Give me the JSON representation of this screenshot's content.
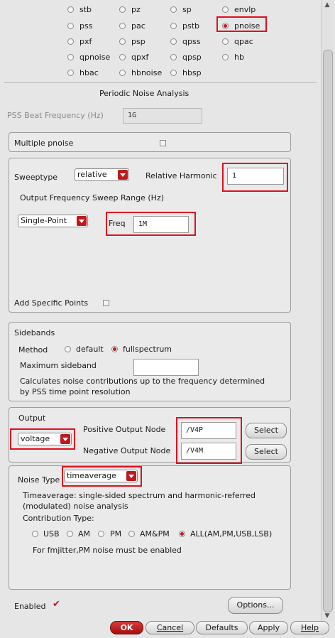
{
  "analyses": [
    "stb",
    "pz",
    "sp",
    "envlp",
    "pss",
    "pac",
    "pstb",
    "pnoise",
    "pxf",
    "psp",
    "qpss",
    "qpac",
    "qpnoise",
    "qpxf",
    "qpsp",
    "hb",
    "hbac",
    "hbnoise",
    "hbsp"
  ],
  "selected_analysis": "pnoise",
  "section_title": "Periodic Noise Analysis",
  "pss_beat": {
    "label": "PSS Beat Frequency (Hz)",
    "value": "1G"
  },
  "multiple_pnoise": {
    "label": "Multiple pnoise"
  },
  "sweep": {
    "sweeptype_label": "Sweeptype",
    "sweeptype_value": "relative",
    "relative_harmonic_label": "Relative Harmonic",
    "relative_harmonic_value": "1",
    "range_title": "Output Frequency Sweep Range (Hz)",
    "range_value": "Single-Point",
    "freq_label": "Freq",
    "freq_value": "1M",
    "add_points_label": "Add Specific Points"
  },
  "sidebands": {
    "title": "Sidebands",
    "method_label": "Method",
    "method_options": [
      "default",
      "fullspectrum"
    ],
    "method_selected": "fullspectrum",
    "max_sideband_label": "Maximum sideband",
    "note_line1": "Calculates noise contributions up to the frequency determined",
    "note_line2": "by PSS time point resolution"
  },
  "output": {
    "title": "Output",
    "type_value": "voltage",
    "pos_label": "Positive Output Node",
    "pos_value": "/V4P",
    "neg_label": "Negative Output Node",
    "neg_value": "/V4M",
    "select_label": "Select"
  },
  "noise": {
    "type_label": "Noise Type",
    "type_value": "timeaverage",
    "desc_line1": "Timeaverage: single-sided spectrum and harmonic-referred",
    "desc_line2": "(modulated) noise analysis",
    "contrib_label": "Contribution Type:",
    "contrib_options": [
      "USB",
      "AM",
      "PM",
      "AM&PM",
      "ALL(AM,PM,USB,LSB)"
    ],
    "contrib_selected": "ALL(AM,PM,USB,LSB)",
    "fmjitter_note": "For fmjitter,PM noise must be enabled"
  },
  "enabled_label": "Enabled",
  "options_button": "Options...",
  "buttons": {
    "ok": "OK",
    "cancel": "Cancel",
    "defaults": "Defaults",
    "apply": "Apply",
    "help": "Help"
  }
}
